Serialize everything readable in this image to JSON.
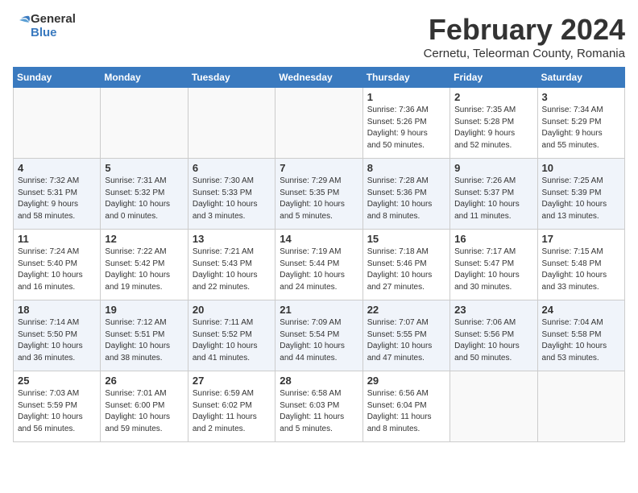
{
  "header": {
    "logo_general": "General",
    "logo_blue": "Blue",
    "month_title": "February 2024",
    "subtitle": "Cernetu, Teleorman County, Romania"
  },
  "calendar": {
    "weekdays": [
      "Sunday",
      "Monday",
      "Tuesday",
      "Wednesday",
      "Thursday",
      "Friday",
      "Saturday"
    ],
    "weeks": [
      [
        {
          "day": "",
          "info": ""
        },
        {
          "day": "",
          "info": ""
        },
        {
          "day": "",
          "info": ""
        },
        {
          "day": "",
          "info": ""
        },
        {
          "day": "1",
          "info": "Sunrise: 7:36 AM\nSunset: 5:26 PM\nDaylight: 9 hours\nand 50 minutes."
        },
        {
          "day": "2",
          "info": "Sunrise: 7:35 AM\nSunset: 5:28 PM\nDaylight: 9 hours\nand 52 minutes."
        },
        {
          "day": "3",
          "info": "Sunrise: 7:34 AM\nSunset: 5:29 PM\nDaylight: 9 hours\nand 55 minutes."
        }
      ],
      [
        {
          "day": "4",
          "info": "Sunrise: 7:32 AM\nSunset: 5:31 PM\nDaylight: 9 hours\nand 58 minutes."
        },
        {
          "day": "5",
          "info": "Sunrise: 7:31 AM\nSunset: 5:32 PM\nDaylight: 10 hours\nand 0 minutes."
        },
        {
          "day": "6",
          "info": "Sunrise: 7:30 AM\nSunset: 5:33 PM\nDaylight: 10 hours\nand 3 minutes."
        },
        {
          "day": "7",
          "info": "Sunrise: 7:29 AM\nSunset: 5:35 PM\nDaylight: 10 hours\nand 5 minutes."
        },
        {
          "day": "8",
          "info": "Sunrise: 7:28 AM\nSunset: 5:36 PM\nDaylight: 10 hours\nand 8 minutes."
        },
        {
          "day": "9",
          "info": "Sunrise: 7:26 AM\nSunset: 5:37 PM\nDaylight: 10 hours\nand 11 minutes."
        },
        {
          "day": "10",
          "info": "Sunrise: 7:25 AM\nSunset: 5:39 PM\nDaylight: 10 hours\nand 13 minutes."
        }
      ],
      [
        {
          "day": "11",
          "info": "Sunrise: 7:24 AM\nSunset: 5:40 PM\nDaylight: 10 hours\nand 16 minutes."
        },
        {
          "day": "12",
          "info": "Sunrise: 7:22 AM\nSunset: 5:42 PM\nDaylight: 10 hours\nand 19 minutes."
        },
        {
          "day": "13",
          "info": "Sunrise: 7:21 AM\nSunset: 5:43 PM\nDaylight: 10 hours\nand 22 minutes."
        },
        {
          "day": "14",
          "info": "Sunrise: 7:19 AM\nSunset: 5:44 PM\nDaylight: 10 hours\nand 24 minutes."
        },
        {
          "day": "15",
          "info": "Sunrise: 7:18 AM\nSunset: 5:46 PM\nDaylight: 10 hours\nand 27 minutes."
        },
        {
          "day": "16",
          "info": "Sunrise: 7:17 AM\nSunset: 5:47 PM\nDaylight: 10 hours\nand 30 minutes."
        },
        {
          "day": "17",
          "info": "Sunrise: 7:15 AM\nSunset: 5:48 PM\nDaylight: 10 hours\nand 33 minutes."
        }
      ],
      [
        {
          "day": "18",
          "info": "Sunrise: 7:14 AM\nSunset: 5:50 PM\nDaylight: 10 hours\nand 36 minutes."
        },
        {
          "day": "19",
          "info": "Sunrise: 7:12 AM\nSunset: 5:51 PM\nDaylight: 10 hours\nand 38 minutes."
        },
        {
          "day": "20",
          "info": "Sunrise: 7:11 AM\nSunset: 5:52 PM\nDaylight: 10 hours\nand 41 minutes."
        },
        {
          "day": "21",
          "info": "Sunrise: 7:09 AM\nSunset: 5:54 PM\nDaylight: 10 hours\nand 44 minutes."
        },
        {
          "day": "22",
          "info": "Sunrise: 7:07 AM\nSunset: 5:55 PM\nDaylight: 10 hours\nand 47 minutes."
        },
        {
          "day": "23",
          "info": "Sunrise: 7:06 AM\nSunset: 5:56 PM\nDaylight: 10 hours\nand 50 minutes."
        },
        {
          "day": "24",
          "info": "Sunrise: 7:04 AM\nSunset: 5:58 PM\nDaylight: 10 hours\nand 53 minutes."
        }
      ],
      [
        {
          "day": "25",
          "info": "Sunrise: 7:03 AM\nSunset: 5:59 PM\nDaylight: 10 hours\nand 56 minutes."
        },
        {
          "day": "26",
          "info": "Sunrise: 7:01 AM\nSunset: 6:00 PM\nDaylight: 10 hours\nand 59 minutes."
        },
        {
          "day": "27",
          "info": "Sunrise: 6:59 AM\nSunset: 6:02 PM\nDaylight: 11 hours\nand 2 minutes."
        },
        {
          "day": "28",
          "info": "Sunrise: 6:58 AM\nSunset: 6:03 PM\nDaylight: 11 hours\nand 5 minutes."
        },
        {
          "day": "29",
          "info": "Sunrise: 6:56 AM\nSunset: 6:04 PM\nDaylight: 11 hours\nand 8 minutes."
        },
        {
          "day": "",
          "info": ""
        },
        {
          "day": "",
          "info": ""
        }
      ]
    ]
  }
}
